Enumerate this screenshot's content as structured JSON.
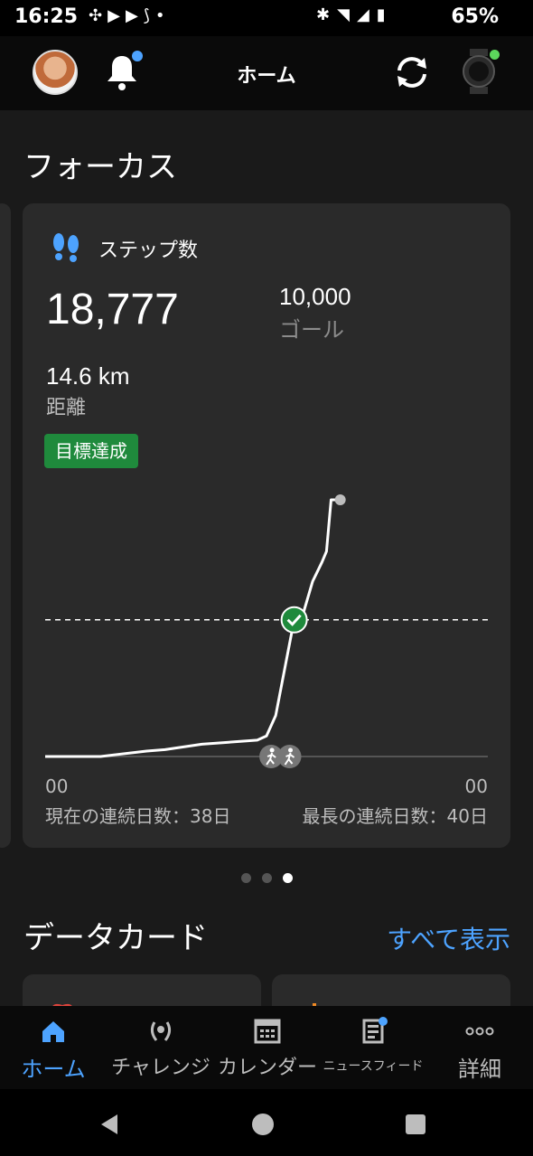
{
  "status_bar": {
    "time": "16:25",
    "battery": "65%",
    "left_icons": [
      "pinwheel-icon",
      "youtube-icon",
      "youtube-icon",
      "sync-app-icon",
      "dot-icon"
    ],
    "right_icons": [
      "bluetooth-icon",
      "wifi-icon",
      "signal-icon",
      "battery-icon"
    ]
  },
  "header": {
    "title": "ホーム"
  },
  "focus": {
    "section_title": "フォーカス",
    "card": {
      "label": "ステップ数",
      "steps": "18,777",
      "goal_value": "10,000",
      "goal_label": "ゴール",
      "distance_value": "14.6 km",
      "distance_label": "距離",
      "badge": "目標達成",
      "axis_left": "00",
      "axis_right": "00",
      "current_streak": "現在の連続日数：38日",
      "longest_streak": "最長の連続日数：40日"
    },
    "pager": {
      "count": 3,
      "active": 3
    }
  },
  "data_cards": {
    "section_title": "データカード",
    "see_all": "すべて表示"
  },
  "bottom_nav": {
    "items": [
      {
        "label": "ホーム",
        "icon": "home-icon",
        "active": true
      },
      {
        "label": "チャレンジ",
        "icon": "laurel-icon",
        "active": false
      },
      {
        "label": "カレンダー",
        "icon": "calendar-icon",
        "active": false
      },
      {
        "label": "ニュースフィード",
        "icon": "newsfeed-icon",
        "active": false
      },
      {
        "label": "詳細",
        "icon": "more-icon",
        "active": false
      }
    ]
  },
  "colors": {
    "accent": "#4da3ff",
    "goal_green": "#1f8a3c",
    "background": "#1a1a1a",
    "card": "#2a2a2a"
  },
  "chart_data": {
    "type": "line",
    "x": [
      0,
      6,
      11,
      13,
      17,
      21,
      23,
      24,
      25,
      27,
      28,
      29,
      30,
      30.5,
      31,
      32
    ],
    "values": [
      0,
      0,
      400,
      500,
      900,
      1100,
      1200,
      1500,
      3000,
      10000,
      10500,
      12800,
      14200,
      15000,
      18777,
      18777
    ],
    "goal": 10000,
    "ylim": [
      0,
      18777
    ],
    "xlim": [
      0,
      48
    ],
    "xtick_labels": [
      "00",
      "00"
    ],
    "goal_marker": "check",
    "activity_markers": [
      "walk-icon",
      "walk-icon"
    ],
    "grid": false
  }
}
